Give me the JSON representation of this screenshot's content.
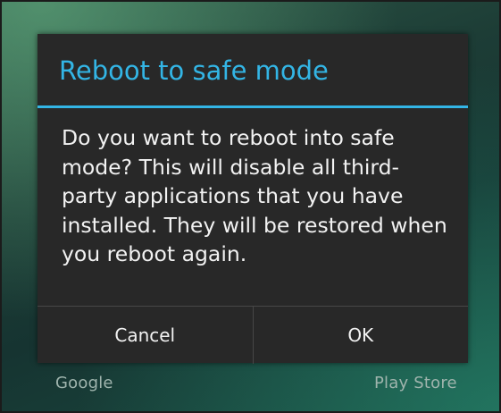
{
  "dialog": {
    "title": "Reboot to safe mode",
    "message": "Do you want to reboot into safe mode? This will disable all third-party applications that you have installed. They will be restored when you reboot again.",
    "cancel_label": "Cancel",
    "ok_label": "OK"
  },
  "home_screen": {
    "apps": [
      "Google",
      "Play Store"
    ]
  },
  "colors": {
    "accent": "#33b5e5",
    "dialog_background": "#282828",
    "text": "#f2f2f2"
  }
}
